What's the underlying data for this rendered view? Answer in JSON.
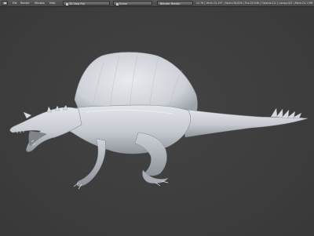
{
  "header": {
    "menus": [
      "File",
      "Render",
      "Window",
      "Help"
    ],
    "screen_layout": "3D View Full",
    "scene": "Scene",
    "render_engine": "Blender Render",
    "stats": "v2.76 | Verts:15,197 | Faces:28,826 | Tris:28,948 | Objects:1/1 | Lamps:0/2 | Mem:24.1 MB"
  },
  "colors": {
    "viewport_bg": "#3d3d3d",
    "header_bg": "#4e4e4e",
    "model": "#c8ccd2"
  },
  "icons": [
    "editor-type-icon",
    "screen-layout-icon",
    "scene-icon"
  ]
}
